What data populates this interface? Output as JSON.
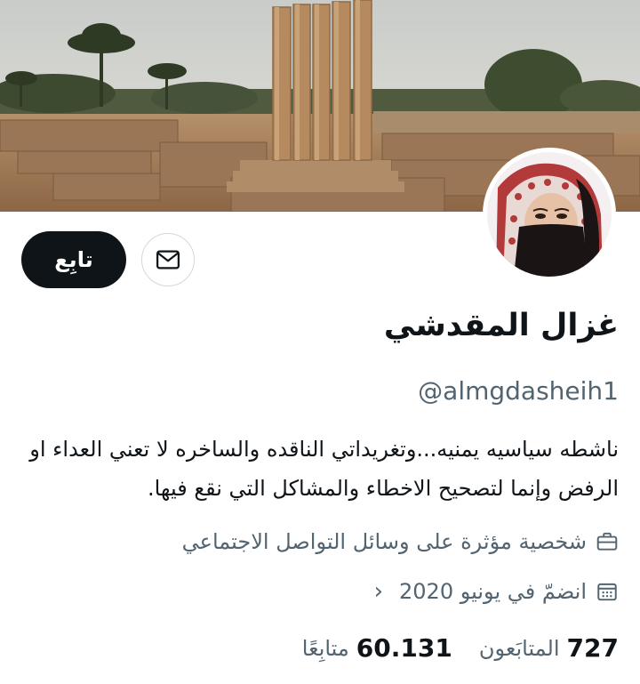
{
  "profile": {
    "display_name": "غزال المقدشي",
    "handle": "@almgdasheih1",
    "bio": "ناشطه سياسيه يمنيه...وتغريداتي الناقده والساخره لا تعني العداء او الرفض وإنما لتصحيح الاخطاء والمشاكل التي نقع فيها.",
    "category": "شخصية مؤثرة على وسائل التواصل الاجتماعي",
    "joined": "انضمّ في يونيو 2020",
    "following_count": "727",
    "following_label": "المتابَعون",
    "followers_count": "60.131",
    "followers_label": "متابِعًا"
  },
  "actions": {
    "follow_label": "تابِع"
  },
  "icons": {
    "message": "envelope-icon",
    "category": "briefcase-icon",
    "joined": "calendar-icon",
    "chevron": "chevron-left-icon"
  },
  "colors": {
    "text_primary": "#0f1419",
    "text_secondary": "#536471",
    "border": "#cfd9de",
    "button_bg": "#0f1419"
  }
}
